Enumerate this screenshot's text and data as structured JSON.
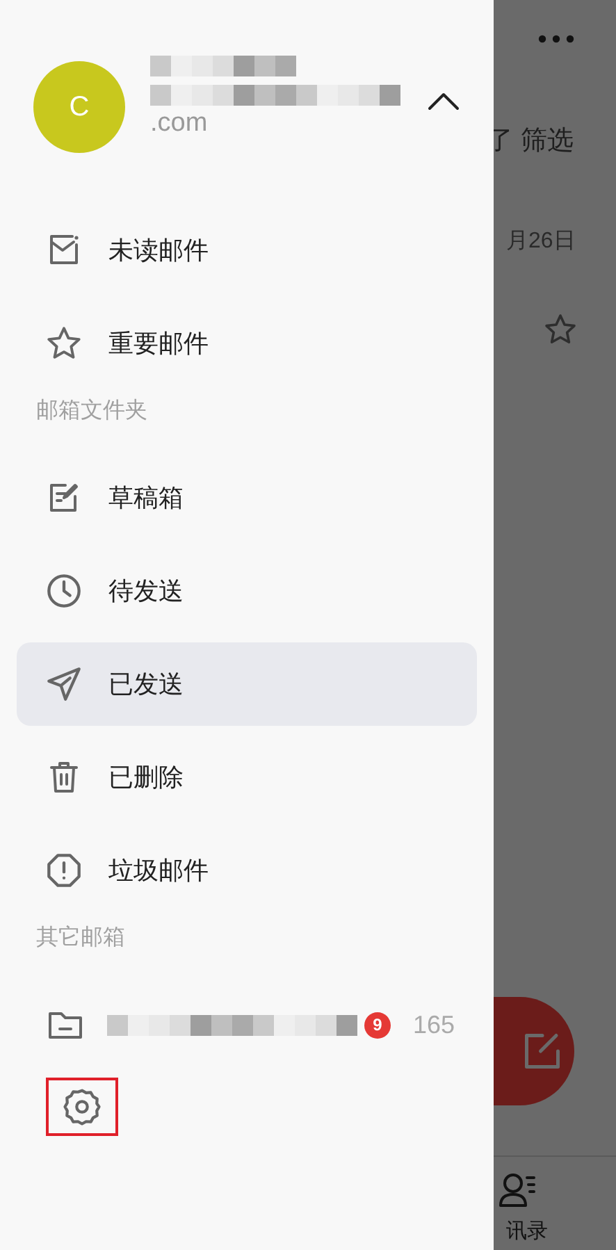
{
  "account": {
    "avatar_letter": "C",
    "email_suffix": ".com",
    "expanded": true
  },
  "menu": [
    {
      "kind": "unread",
      "label": "未读邮件",
      "selected": false
    },
    {
      "kind": "star",
      "label": "重要邮件",
      "selected": false
    }
  ],
  "folders_header": "邮箱文件夹",
  "folders": [
    {
      "kind": "draft",
      "label": "草稿箱",
      "selected": false
    },
    {
      "kind": "clock",
      "label": "待发送",
      "selected": false
    },
    {
      "kind": "send",
      "label": "已发送",
      "selected": true
    },
    {
      "kind": "trash",
      "label": "已删除",
      "selected": false
    },
    {
      "kind": "spam",
      "label": "垃圾邮件",
      "selected": false
    }
  ],
  "other_header": "其它邮箱",
  "other_mailboxes": [
    {
      "badge": "9",
      "count": "165"
    }
  ],
  "settings": {
    "highlighted": true
  },
  "background": {
    "filter_label": "了 筛选",
    "date": "月26日",
    "nav_label": "讯录"
  }
}
